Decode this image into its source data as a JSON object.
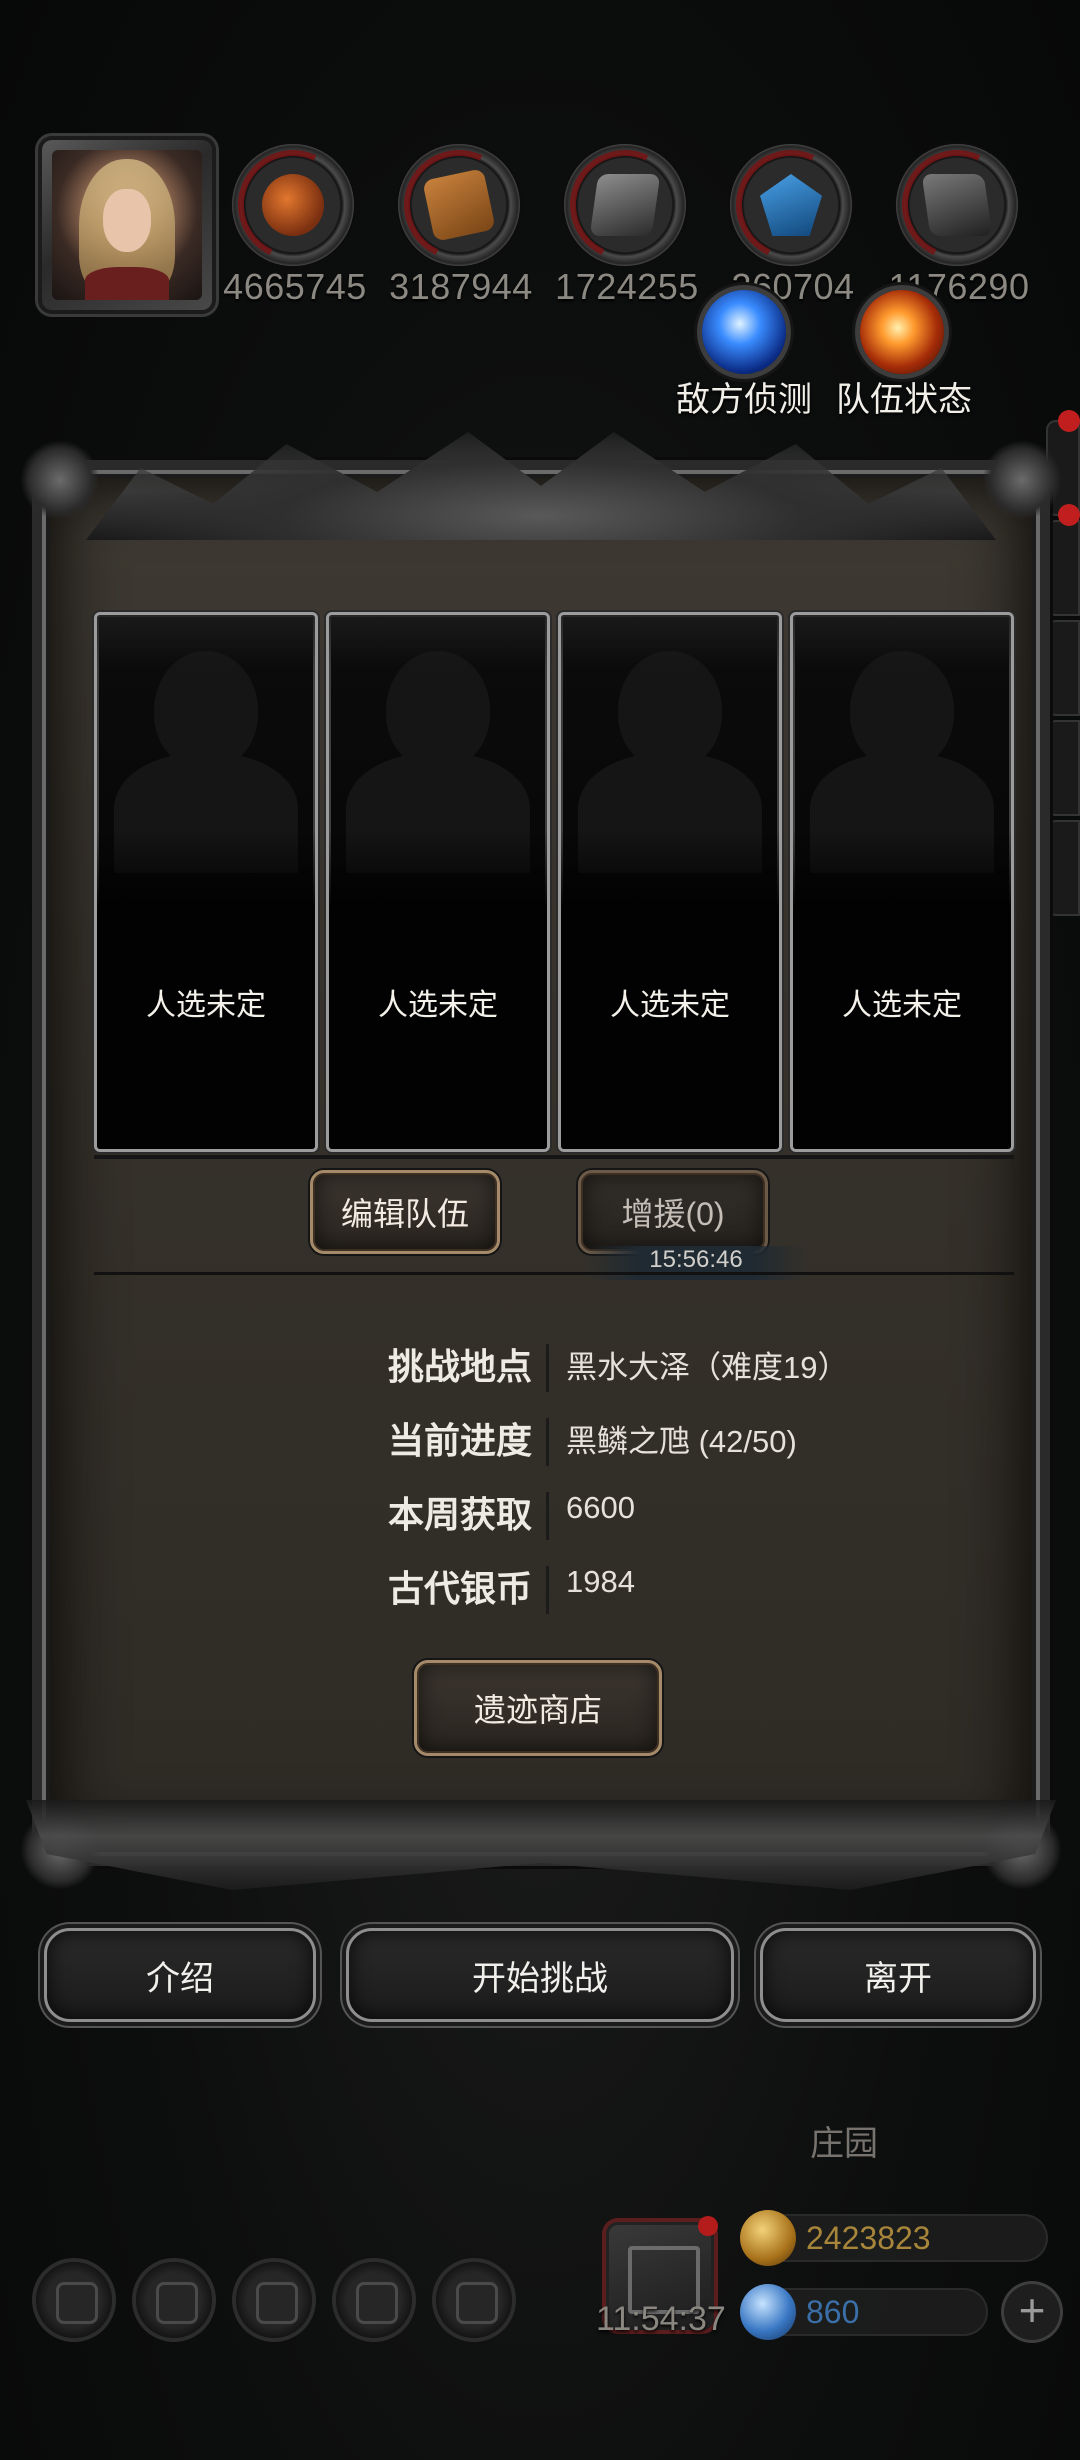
{
  "resources": [
    {
      "icon": "copper-icon",
      "value": "4665745"
    },
    {
      "icon": "wood-icon",
      "value": "3187944"
    },
    {
      "icon": "iron-icon",
      "value": "1724255"
    },
    {
      "icon": "crystal-icon",
      "value": "260704"
    },
    {
      "icon": "steel-icon",
      "value": "1176290"
    }
  ],
  "top_actions": {
    "enemy_scout": "敌方侦测",
    "team_status": "队伍状态"
  },
  "slots": [
    {
      "label": "人选未定"
    },
    {
      "label": "人选未定"
    },
    {
      "label": "人选未定"
    },
    {
      "label": "人选未定"
    }
  ],
  "team": {
    "edit_label": "编辑队伍",
    "reinforce_label": "增援(0)",
    "timer": "15:56:46"
  },
  "info": {
    "location": {
      "label": "挑战地点",
      "value": "黑水大泽（难度19）"
    },
    "progress": {
      "label": "当前进度",
      "value": "黑鳞之虺 (42/50)"
    },
    "weekly": {
      "label": "本周获取",
      "value": "6600"
    },
    "coins": {
      "label": "古代银币",
      "value": "1984"
    }
  },
  "shop_label": "遗迹商店",
  "actions": {
    "intro": "介绍",
    "start": "开始挑战",
    "leave": "离开"
  },
  "footer": {
    "zone": "庄园",
    "clock": "11:54:37",
    "gold": "2423823",
    "diamonds": "860"
  },
  "colors": {
    "panel_bg": "#36322b",
    "button_border": "#a58a6a",
    "gold_text": "#a7853a",
    "blue_text": "#3b6fa8",
    "alert_red": "#c11f1f"
  }
}
